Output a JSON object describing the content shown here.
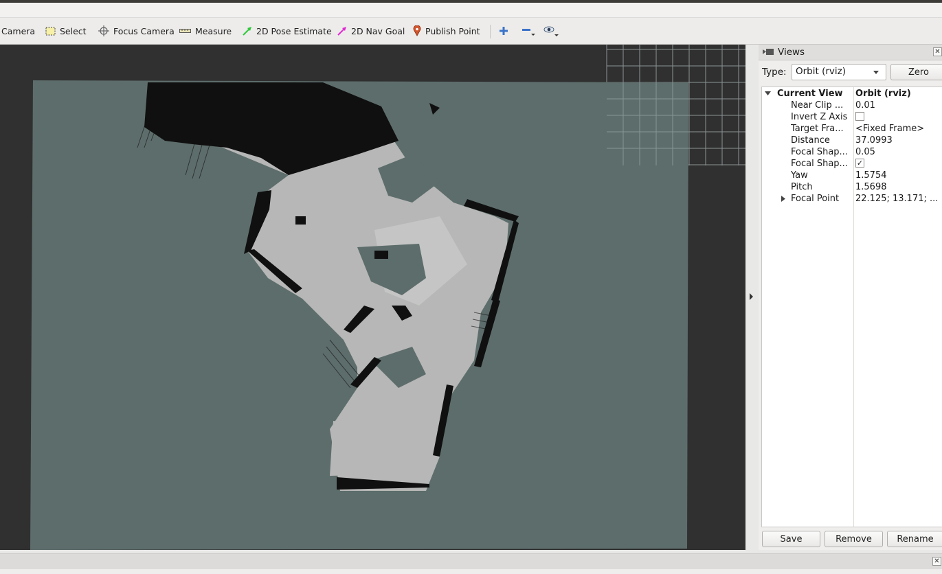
{
  "toolbar": {
    "tools": [
      {
        "label": "Camera",
        "icon": "camera-icon"
      },
      {
        "label": "Select",
        "icon": "select-icon"
      },
      {
        "label": "Focus Camera",
        "icon": "focus-camera-icon"
      },
      {
        "label": "Measure",
        "icon": "ruler-icon"
      },
      {
        "label": "2D Pose Estimate",
        "icon": "pose-arrow-icon",
        "color": "#2ec93a"
      },
      {
        "label": "2D Nav Goal",
        "icon": "nav-goal-arrow-icon",
        "color": "#e02ad1"
      },
      {
        "label": "Publish Point",
        "icon": "map-pin-icon",
        "color": "#d2552c"
      }
    ],
    "extra_icons": [
      "add-tool-icon",
      "remove-tool-icon",
      "eye-icon"
    ]
  },
  "views_panel": {
    "title": "Views",
    "type_label": "Type:",
    "type_value": "Orbit (rviz)",
    "zero_label": "Zero",
    "tree": {
      "header_key": "Current View",
      "header_value": "Orbit (rviz)",
      "rows": [
        {
          "key": "Near Clip ...",
          "value": "0.01"
        },
        {
          "key": "Invert Z Axis",
          "value": "",
          "checkbox": "unchecked"
        },
        {
          "key": "Target Fra...",
          "value": "<Fixed Frame>"
        },
        {
          "key": "Distance",
          "value": "37.0993"
        },
        {
          "key": "Focal Shap...",
          "value": "0.05"
        },
        {
          "key": "Focal Shap...",
          "value": "",
          "checkbox": "checked"
        },
        {
          "key": "Yaw",
          "value": "1.5754"
        },
        {
          "key": "Pitch",
          "value": "1.5698"
        },
        {
          "key": "Focal Point",
          "value": "22.125; 13.171; ..."
        }
      ]
    },
    "buttons": {
      "save": "Save",
      "remove": "Remove",
      "rename": "Rename"
    }
  },
  "colors": {
    "map_unknown": "#5d6d6b",
    "map_free": "#b6b7b6",
    "map_occupied": "#101010",
    "viewport_bg": "#303030"
  }
}
